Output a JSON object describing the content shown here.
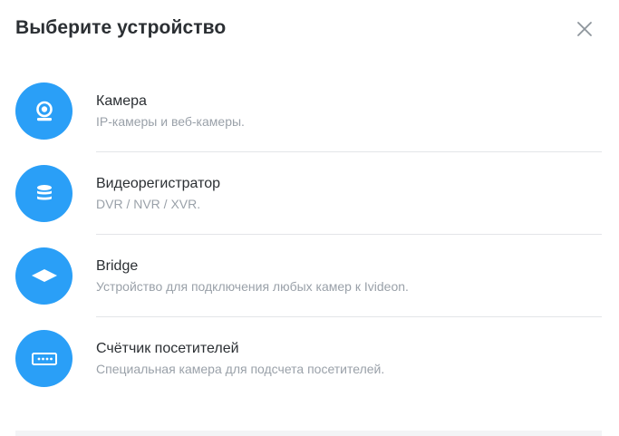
{
  "dialog": {
    "title": "Выберите устройство",
    "close_icon": "close-icon"
  },
  "devices": [
    {
      "name": "Камера",
      "description": "IP-камеры и веб-камеры.",
      "icon": "webcam-icon"
    },
    {
      "name": "Видеорегистратор",
      "description": "DVR / NVR / XVR.",
      "icon": "database-icon"
    },
    {
      "name": "Bridge",
      "description": "Устройство для подключения любых камер к Ivideon.",
      "icon": "bridge-icon"
    },
    {
      "name": "Счётчик посетителей",
      "description": "Специальная камера для подсчета посетителей.",
      "icon": "counter-icon"
    }
  ],
  "colors": {
    "accent": "#2a9ff7",
    "title_text": "#2b2f33",
    "description_text": "#9aa1a9",
    "divider": "#e3e5e8"
  }
}
